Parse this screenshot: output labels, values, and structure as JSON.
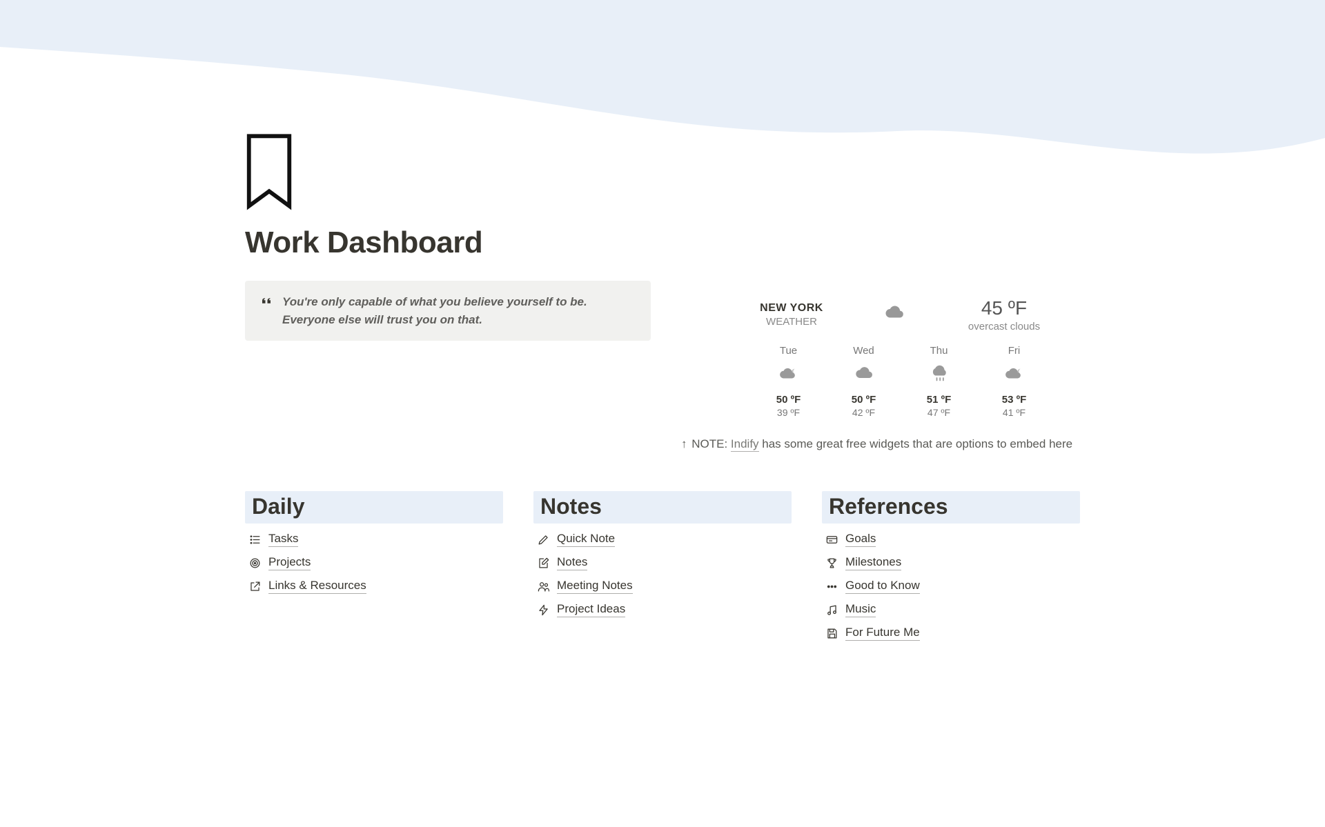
{
  "page": {
    "title": "Work Dashboard"
  },
  "quote": {
    "text": "You're only capable of what you believe yourself to be. Everyone else will trust you on that."
  },
  "weather": {
    "city": "NEW YORK",
    "sub": "WEATHER",
    "current_temp": "45 ºF",
    "current_desc": "overcast clouds",
    "forecast": [
      {
        "day": "Tue",
        "icon": "cloud-night",
        "hi": "50 ºF",
        "lo": "39 ºF"
      },
      {
        "day": "Wed",
        "icon": "cloud",
        "hi": "50 ºF",
        "lo": "42 ºF"
      },
      {
        "day": "Thu",
        "icon": "cloud-rain",
        "hi": "51 ºF",
        "lo": "47 ºF"
      },
      {
        "day": "Fri",
        "icon": "cloud-night",
        "hi": "53 ºF",
        "lo": "41 ºF"
      }
    ]
  },
  "note": {
    "arrow": "↑",
    "prefix": "NOTE: ",
    "link_text": "Indify",
    "suffix": " has some great free widgets that are options to embed here"
  },
  "sections": [
    {
      "title": "Daily",
      "items": [
        {
          "icon": "list",
          "label": "Tasks"
        },
        {
          "icon": "target",
          "label": "Projects"
        },
        {
          "icon": "external",
          "label": "Links & Resources"
        }
      ]
    },
    {
      "title": "Notes",
      "items": [
        {
          "icon": "pencil",
          "label": "Quick Note"
        },
        {
          "icon": "edit",
          "label": "Notes"
        },
        {
          "icon": "people",
          "label": "Meeting Notes"
        },
        {
          "icon": "lightning",
          "label": "Project Ideas"
        }
      ]
    },
    {
      "title": "References",
      "items": [
        {
          "icon": "card",
          "label": "Goals"
        },
        {
          "icon": "trophy",
          "label": "Milestones"
        },
        {
          "icon": "dots",
          "label": "Good to Know"
        },
        {
          "icon": "music",
          "label": "Music"
        },
        {
          "icon": "save",
          "label": "For Future Me"
        }
      ]
    }
  ]
}
